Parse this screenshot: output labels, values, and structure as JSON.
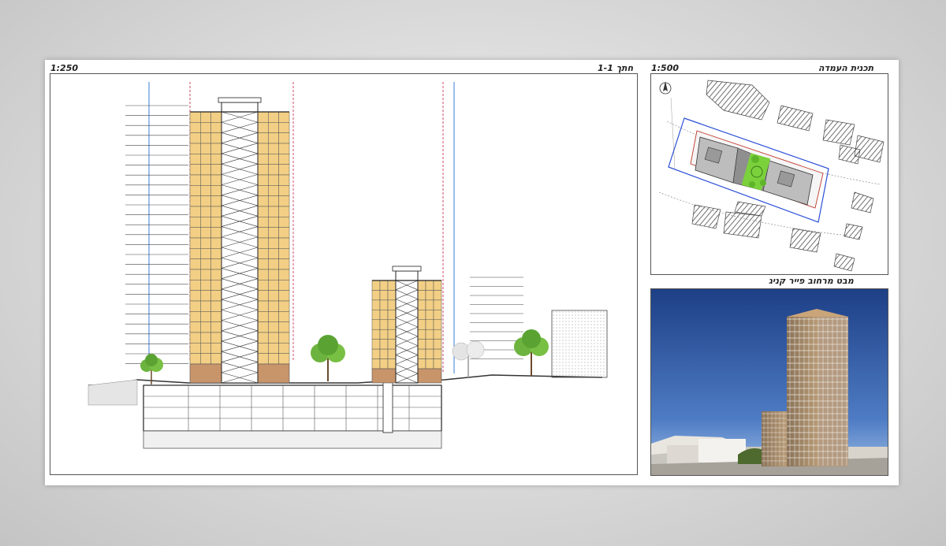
{
  "section": {
    "title": "חתך 1-1",
    "scale": "1:250"
  },
  "site_plan": {
    "title": "תכנית העמדה",
    "scale": "1:500"
  },
  "render_view": {
    "title": "מבט מרחוב פייר קניג"
  },
  "colors": {
    "apartment": "#f2cf85",
    "commercial": "#c8946a",
    "axis_blue": "#3b7fd6",
    "axis_red": "#d24b6a",
    "tree": "#6db33f",
    "sky_top": "#1d3f86",
    "sky_bottom": "#8fb6e6"
  }
}
